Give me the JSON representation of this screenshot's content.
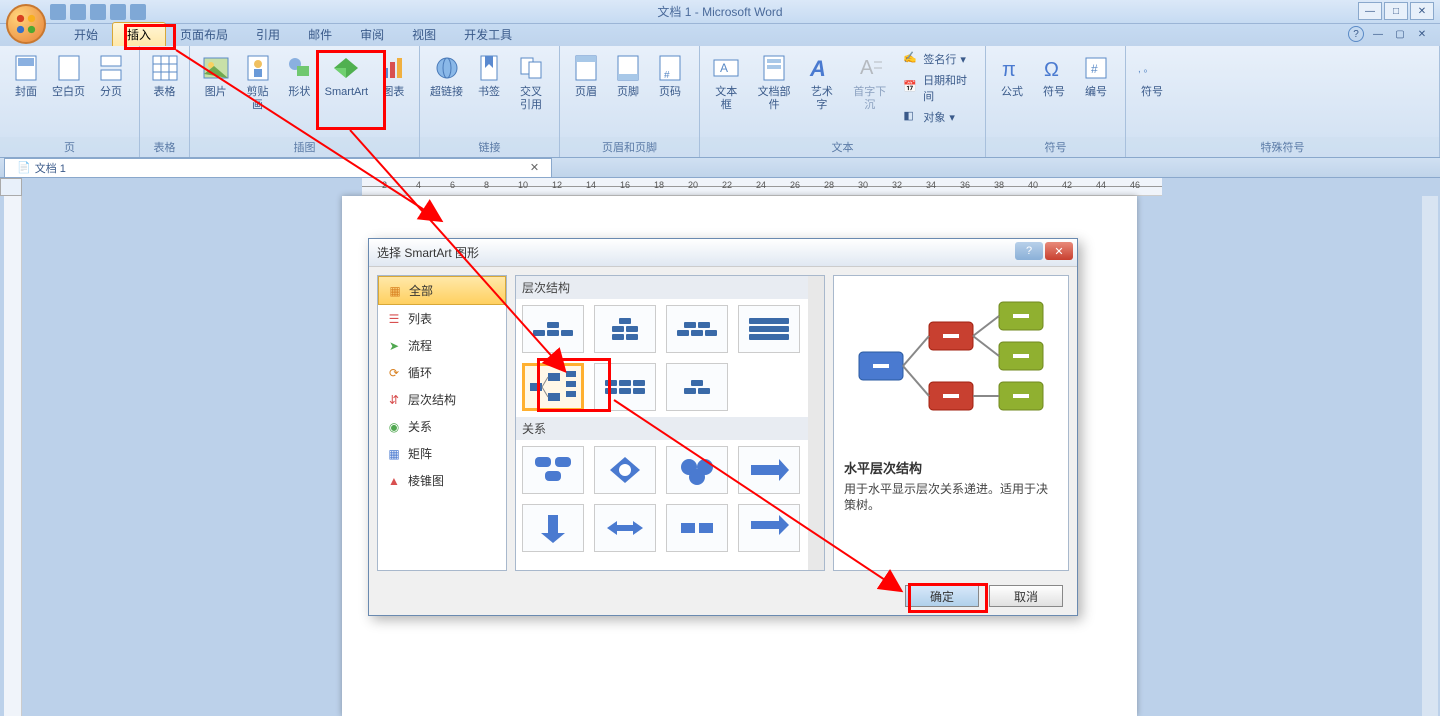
{
  "title": "文档 1 - Microsoft Word",
  "tabs": [
    "开始",
    "插入",
    "页面布局",
    "引用",
    "邮件",
    "审阅",
    "视图",
    "开发工具"
  ],
  "active_tab_index": 1,
  "ribbon_groups": {
    "page": {
      "label": "页",
      "items": [
        "封面",
        "空白页",
        "分页"
      ]
    },
    "table": {
      "label": "表格",
      "items": [
        "表格"
      ]
    },
    "illus": {
      "label": "插图",
      "items": [
        "图片",
        "剪贴画",
        "形状",
        "SmartArt",
        "图表"
      ]
    },
    "links": {
      "label": "链接",
      "items": [
        "超链接",
        "书签",
        "交叉\n引用"
      ]
    },
    "hf": {
      "label": "页眉和页脚",
      "items": [
        "页眉",
        "页脚",
        "页码"
      ]
    },
    "text": {
      "label": "文本",
      "items": [
        "文本框",
        "文档部件",
        "艺术字",
        "首字下沉"
      ],
      "small": [
        "签名行",
        "日期和时间",
        "对象"
      ]
    },
    "symbols": {
      "label": "符号",
      "items": [
        "公式",
        "符号",
        "编号"
      ]
    },
    "special": {
      "label": "特殊符号",
      "items": [
        "符号"
      ]
    }
  },
  "doc_tab": "文档 1",
  "ruler_marks": [
    "2",
    "4",
    "6",
    "8",
    "10",
    "12",
    "14",
    "16",
    "18",
    "20",
    "22",
    "24",
    "26",
    "28",
    "30",
    "32",
    "34",
    "36",
    "38",
    "40",
    "42",
    "44",
    "46"
  ],
  "dialog": {
    "title": "选择 SmartArt 图形",
    "categories": [
      "全部",
      "列表",
      "流程",
      "循环",
      "层次结构",
      "关系",
      "矩阵",
      "棱锥图"
    ],
    "selected_cat_index": 0,
    "sections": [
      "层次结构",
      "关系"
    ],
    "preview_title": "水平层次结构",
    "preview_desc": "用于水平显示层次关系递进。适用于决策树。",
    "ok": "确定",
    "cancel": "取消"
  }
}
